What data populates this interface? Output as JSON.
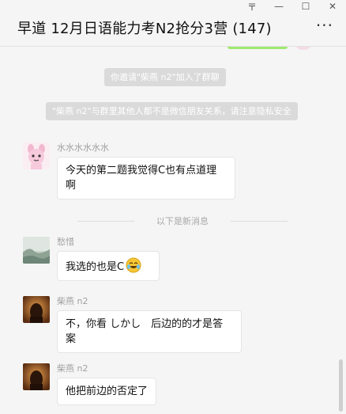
{
  "window": {
    "controls": {
      "pin": "〒",
      "minimize": "—",
      "maximize": "☐",
      "close": "✕"
    },
    "title": "早道 12月日语能力考N2抢分3营 (147)",
    "more": "···"
  },
  "chat": {
    "system_messages": [
      "你邀请\"柴燕 n2\"加入了群聊",
      "\"柴燕 n2\"与群里其他人都不是微信朋友关系，请注意隐私安全"
    ],
    "divider_label": "以下是新消息",
    "messages": [
      {
        "sender": "水水水水水水",
        "text": "今天的第二题我觉得C也有点道理啊"
      },
      {
        "sender": "愁惜",
        "text": "我选的也是C"
      },
      {
        "sender": "柴燕 n2",
        "text": "不，你看 しかし　后边的的才是答案"
      },
      {
        "sender": "柴燕 n2",
        "text": "他把前边的否定了"
      }
    ]
  },
  "colors": {
    "background": "#f5f5f5",
    "bubble": "#ffffff",
    "system_bubble": "#dadada",
    "green_bubble": "#9fe870",
    "sender_text": "#a0a0a0"
  },
  "icons": {
    "emoji": "laughing-crying-emoji-icon"
  }
}
